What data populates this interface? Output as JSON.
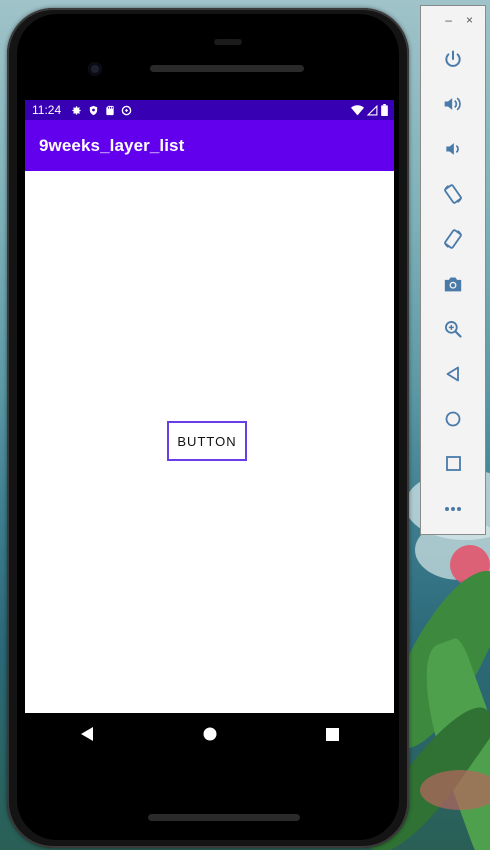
{
  "status_bar": {
    "time": "11:24",
    "left_icons": [
      "gear-icon",
      "shield-icon",
      "sd-card-icon",
      "data-saver-icon"
    ],
    "right_icons": [
      "wifi-icon",
      "signal-icon",
      "battery-icon"
    ]
  },
  "app_bar": {
    "title": "9weeks_layer_list"
  },
  "content": {
    "button_label": "BUTTON"
  },
  "nav_bar": {
    "buttons": [
      "back",
      "home",
      "recents"
    ]
  },
  "emulator_toolbar": {
    "window_controls": {
      "minimize": "–",
      "close": "×"
    },
    "tools": [
      "power",
      "volume-up",
      "volume-down",
      "rotate-left",
      "rotate-right",
      "screenshot",
      "zoom",
      "back",
      "home",
      "overview",
      "more"
    ]
  },
  "colors": {
    "status_bar": "#3700b3",
    "app_bar": "#6200ee",
    "button_border": "#6a3de8",
    "toolbar_icon": "#4a7aa8"
  }
}
